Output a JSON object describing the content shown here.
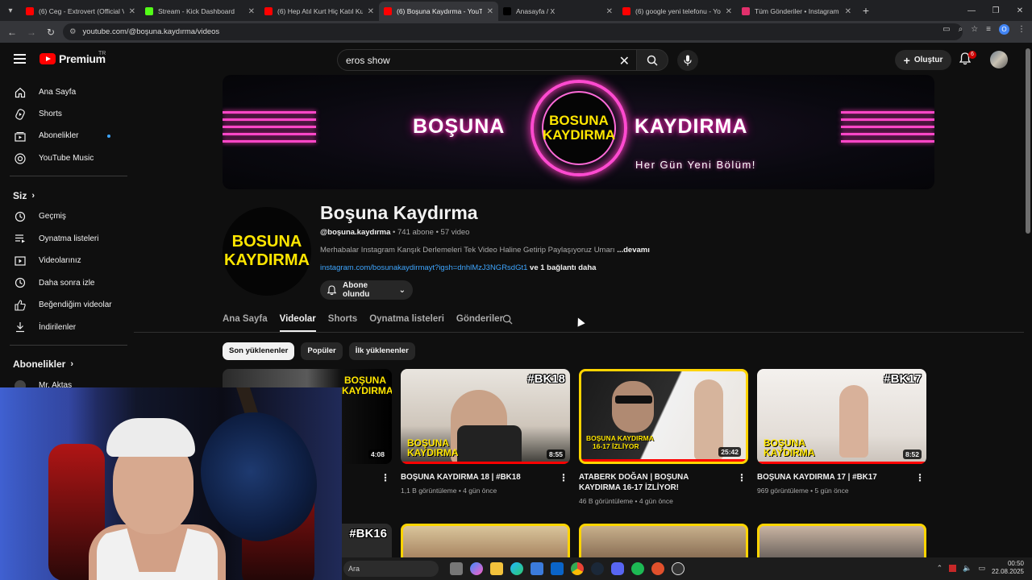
{
  "browser": {
    "tabs": [
      {
        "title": "(6) Ceg - Extrovert (Official Vid",
        "color": "#ff0000",
        "active": false
      },
      {
        "title": "Stream - Kick Dashboard",
        "color": "#53fc18",
        "active": false
      },
      {
        "title": "(6) Hep Atıl Kurt Hiç Katıl Kurt V",
        "color": "#ff0000",
        "active": false
      },
      {
        "title": "(6) Boşuna Kaydırma - YouTube",
        "color": "#ff0000",
        "active": true
      },
      {
        "title": "Anasayfa / X",
        "color": "#000000",
        "active": false
      },
      {
        "title": "(6) google yeni telefonu - YouT",
        "color": "#ff0000",
        "active": false
      },
      {
        "title": "Tüm Gönderiler • Instagram",
        "color": "#e1306c",
        "active": false
      }
    ],
    "url": "youtube.com/@boşuna.kaydırma/videos",
    "profile_initial": "O"
  },
  "header": {
    "logo_text": "Premium",
    "logo_region": "TR",
    "search_value": "eros show",
    "create_label": "Oluştur",
    "notification_count": "6"
  },
  "sidebar": {
    "main": [
      {
        "label": "Ana Sayfa",
        "icon": "home-icon"
      },
      {
        "label": "Shorts",
        "icon": "shorts-icon"
      },
      {
        "label": "Abonelikler",
        "icon": "subscriptions-icon"
      },
      {
        "label": "YouTube Music",
        "icon": "music-icon"
      }
    ],
    "you_heading": "Siz",
    "you": [
      {
        "label": "Geçmiş",
        "icon": "history-icon"
      },
      {
        "label": "Oynatma listeleri",
        "icon": "playlists-icon"
      },
      {
        "label": "Videolarınız",
        "icon": "your-videos-icon"
      },
      {
        "label": "Daha sonra izle",
        "icon": "watch-later-icon"
      },
      {
        "label": "Beğendiğim videolar",
        "icon": "liked-icon"
      },
      {
        "label": "İndirilenler",
        "icon": "download-icon"
      }
    ],
    "subs_heading": "Abonelikler",
    "subs": [
      {
        "label": "Mr. Aktas"
      }
    ]
  },
  "banner": {
    "left_text": "BOŞUNA",
    "right_text": "KAYDIRMA",
    "logo_line1": "BOSUNA",
    "logo_line2": "KAYDIRMA",
    "tagline": "Her Gün Yeni Bölüm!"
  },
  "channel": {
    "avatar_line1": "BOSUNA",
    "avatar_line2": "KAYDIRMA",
    "name": "Boşuna Kaydırma",
    "handle": "@boşuna.kaydırma",
    "subscribers": "741 abone",
    "video_count": "57 video",
    "separator": "•",
    "description": "Merhabalar Instagram Kanşık Derlemeleri Tek Video Haline Getirip Paylaşıyoruz Umarı",
    "more_label": "...devamı",
    "link": "instagram.com/bosunakaydirmayt?igsh=dnhlMzJ3NGRsdGt1",
    "link_extra": "ve 1 bağlantı daha",
    "subscribe_label": "Abone olundu"
  },
  "tabs": [
    {
      "label": "Ana Sayfa",
      "active": false
    },
    {
      "label": "Videolar",
      "active": true
    },
    {
      "label": "Shorts",
      "active": false
    },
    {
      "label": "Oynatma listeleri",
      "active": false
    },
    {
      "label": "Gönderiler",
      "active": false
    }
  ],
  "chips": [
    {
      "label": "Son yüklenenler",
      "active": true
    },
    {
      "label": "Popüler",
      "active": false
    },
    {
      "label": "İlk yüklenenler",
      "active": false
    }
  ],
  "videos": [
    {
      "title": ")",
      "views": "",
      "age": "",
      "duration": "4:08",
      "tag": "",
      "progress": 0
    },
    {
      "title": "BOŞUNA KAYDIRMA 18 | #BK18",
      "views": "1,1 B görüntüleme",
      "age": "4 gün önce",
      "duration": "8:55",
      "tag": "#BK18",
      "progress": 1.0
    },
    {
      "title": "ATABERK DOĞAN | BOŞUNA KAYDIRMA 16-17 İZLİYOR!",
      "views": "46 B görüntüleme",
      "age": "4 gün önce",
      "duration": "25:42",
      "tag": "",
      "progress": 1.0
    },
    {
      "title": "BOŞUNA KAYDIRMA 17 | #BK17",
      "views": "969 görüntüleme",
      "age": "5 gün önce",
      "duration": "8:52",
      "tag": "#BK17",
      "progress": 1.0
    }
  ],
  "second_row_tag": "#BK16",
  "thumb_logo": {
    "line1": "BOŞUNA",
    "line2": "KAYDIRMA"
  },
  "thumb3_text": {
    "line1": "BOŞUNA KAYDIRMA",
    "line2": "16-17 İZLİYOR"
  },
  "taskbar": {
    "search_label": "Ara",
    "time": "00:50",
    "date": "22.08.2025"
  }
}
